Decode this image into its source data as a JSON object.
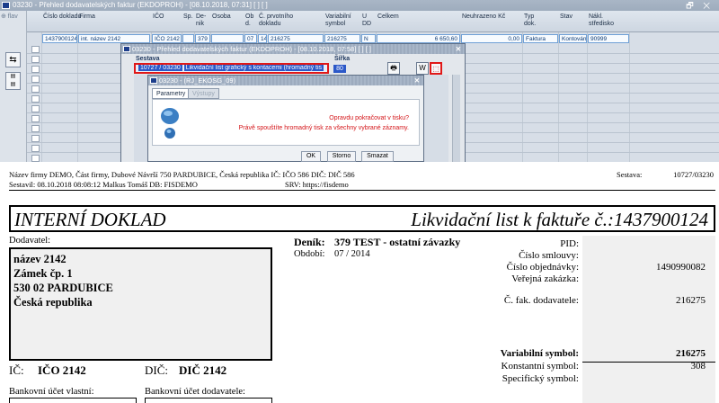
{
  "app": {
    "title": "03230 - Přehled dodavatelských faktur (EKDOPROH) - [08.10.2018, 07:31] [ ] [ ]",
    "window_controls": "🗗 ✕",
    "btn_flav": "⊕ flav",
    "grid_headers": [
      "Číslo dokladu",
      "Firma",
      "IČO",
      "Sp.",
      "De-nik",
      "Osoba",
      "Ob d.",
      "Č. prvotního dokladu",
      "Variabilní symbol",
      "U DD",
      "Celkem",
      "Neuhrazeno Kč",
      "Typ dok.",
      "Stav",
      "Nákl. středisko"
    ],
    "row1": [
      "1437900124",
      "int. název 2142",
      "IČO 2142",
      "",
      "379",
      "",
      "07",
      "14",
      "216275",
      "216275",
      "N",
      "6 650,60",
      "0,00",
      "Faktura",
      "Kontován",
      "90999"
    ]
  },
  "dialog1": {
    "title": "03230 - Přehled dodavatelských faktur (EKDOPROH) - [08.10.2018, 07:58] [ ] [ ]",
    "close": "✕",
    "col_sestava": "Sestava",
    "col_sirka": "Šířka",
    "sel_code": "10727 / 03230",
    "sel_name": "Likvidační list grafický s kontacemi (hromadný tis",
    "sel_width": "80"
  },
  "dialog2": {
    "title": "03230 - (RJ_EKOSG_09)",
    "close": "✕",
    "tab_params": "Parametry",
    "tab_output": "Výstupy",
    "question": "Opravdu pokračovat v tisku?",
    "info": "Právě spouštíte hromadný tisk za všechny vybrané záznamy.",
    "btn_ok": "OK",
    "btn_storno": "Storno",
    "btn_smazat": "Smazat"
  },
  "doc": {
    "header1": "Název firmy DEMO, Část firmy, Dubové Návrší 750 PARDUBICE, Česká republika  IČ: IČO 586  DIČ: DIČ 586",
    "header2": "Sestavil: 08.10.2018 08:08:12 Malkus Tomáš  DB: FISDEMO",
    "srv": "SRV: https://fisdemo",
    "sestava_label": "Sestava:",
    "sestava_value": "10727/03230",
    "title_left": "INTERNÍ DOKLAD",
    "title_right": "Likvidační list k faktuře č.:1437900124",
    "supplier_label": "Dodavatel:",
    "supplier_lines": [
      "název 2142",
      "Zámek čp. 1",
      "530 02 PARDUBICE",
      "Česká republika"
    ],
    "ic_label": "IČ:",
    "ic_value": "IČO 2142",
    "dic_label": "DIČ:",
    "dic_value": "DIČ 2142",
    "bank_own_label": "Bankovní účet vlastní:",
    "bank_sup_label": "Bankovní účet dodavatele:",
    "denik_label": "Deník:",
    "denik_value": "379 TEST - ostatní závazky",
    "obdobi_label": "Období:",
    "obdobi_value": "07 / 2014",
    "right_fields": [
      {
        "label": "PID:",
        "value": "",
        "bold": false
      },
      {
        "label": "Číslo smlouvy:",
        "value": "",
        "bold": false
      },
      {
        "label": "Číslo objednávky:",
        "value": "1490990082",
        "bold": false
      },
      {
        "label": "Veřejná zakázka:",
        "value": "",
        "bold": false
      },
      {
        "label": "Č. fak. dodavatele:",
        "value": "216275",
        "bold": false
      },
      {
        "label": "Variabilní symbol:",
        "value": "216275",
        "bold": true
      },
      {
        "label": "Konstantní symbol:",
        "value": "308",
        "bold": false
      },
      {
        "label": "Specifický symbol:",
        "value": "",
        "bold": false
      }
    ]
  }
}
